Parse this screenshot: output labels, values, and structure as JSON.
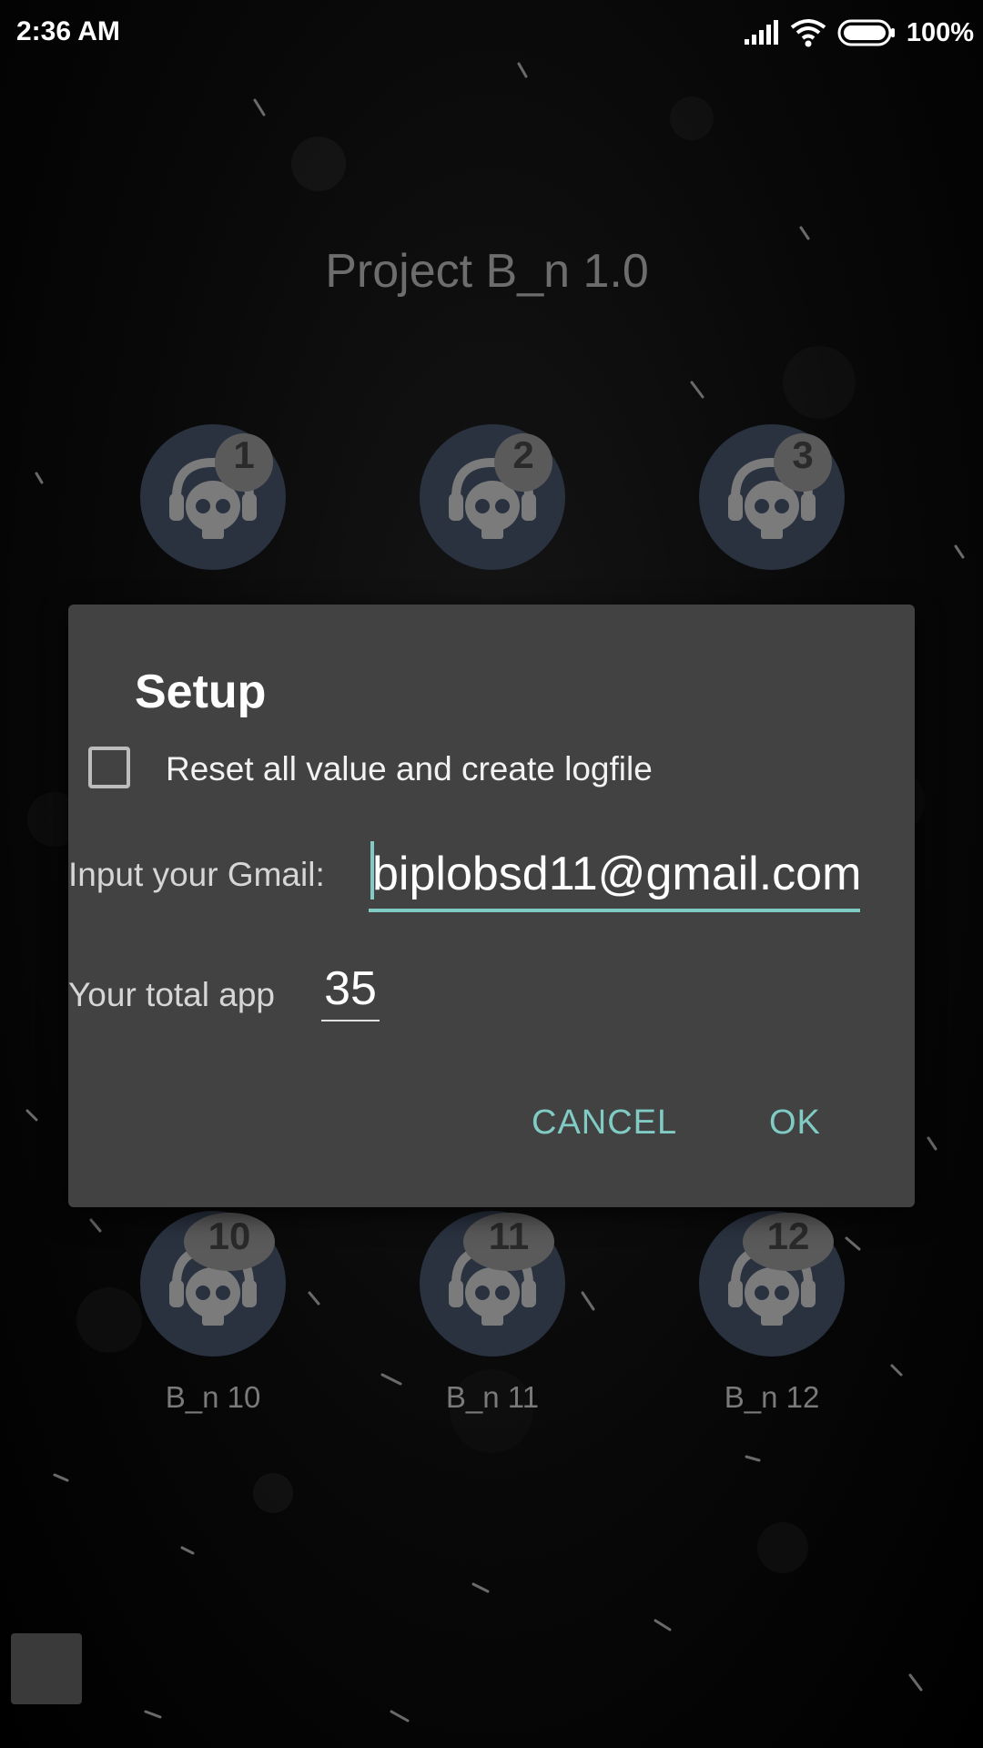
{
  "status_bar": {
    "time": "2:36 AM",
    "battery_percent": "100%",
    "icons": [
      "signal-icon",
      "wifi-icon",
      "battery-icon"
    ]
  },
  "app": {
    "title": "Project B_n 1.0"
  },
  "grid_top": [
    {
      "badge": "1",
      "label": ""
    },
    {
      "badge": "2",
      "label": ""
    },
    {
      "badge": "3",
      "label": ""
    }
  ],
  "grid_bottom": [
    {
      "badge": "10",
      "label": "B_n 10"
    },
    {
      "badge": "11",
      "label": "B_n 11"
    },
    {
      "badge": "12",
      "label": "B_n 12"
    }
  ],
  "dialog": {
    "title": "Setup",
    "checkbox_label": "Reset all value and create logfile",
    "checkbox_checked": false,
    "gmail_label": "Input your Gmail:",
    "gmail_value": "biplobsd11@gmail.com",
    "total_label": "Your total app",
    "total_value": "35",
    "cancel_label": "CANCEL",
    "ok_label": "OK"
  },
  "colors": {
    "accent": "#80cbc4",
    "dialog_bg": "#424242",
    "icon_bg": "#2a3240"
  }
}
